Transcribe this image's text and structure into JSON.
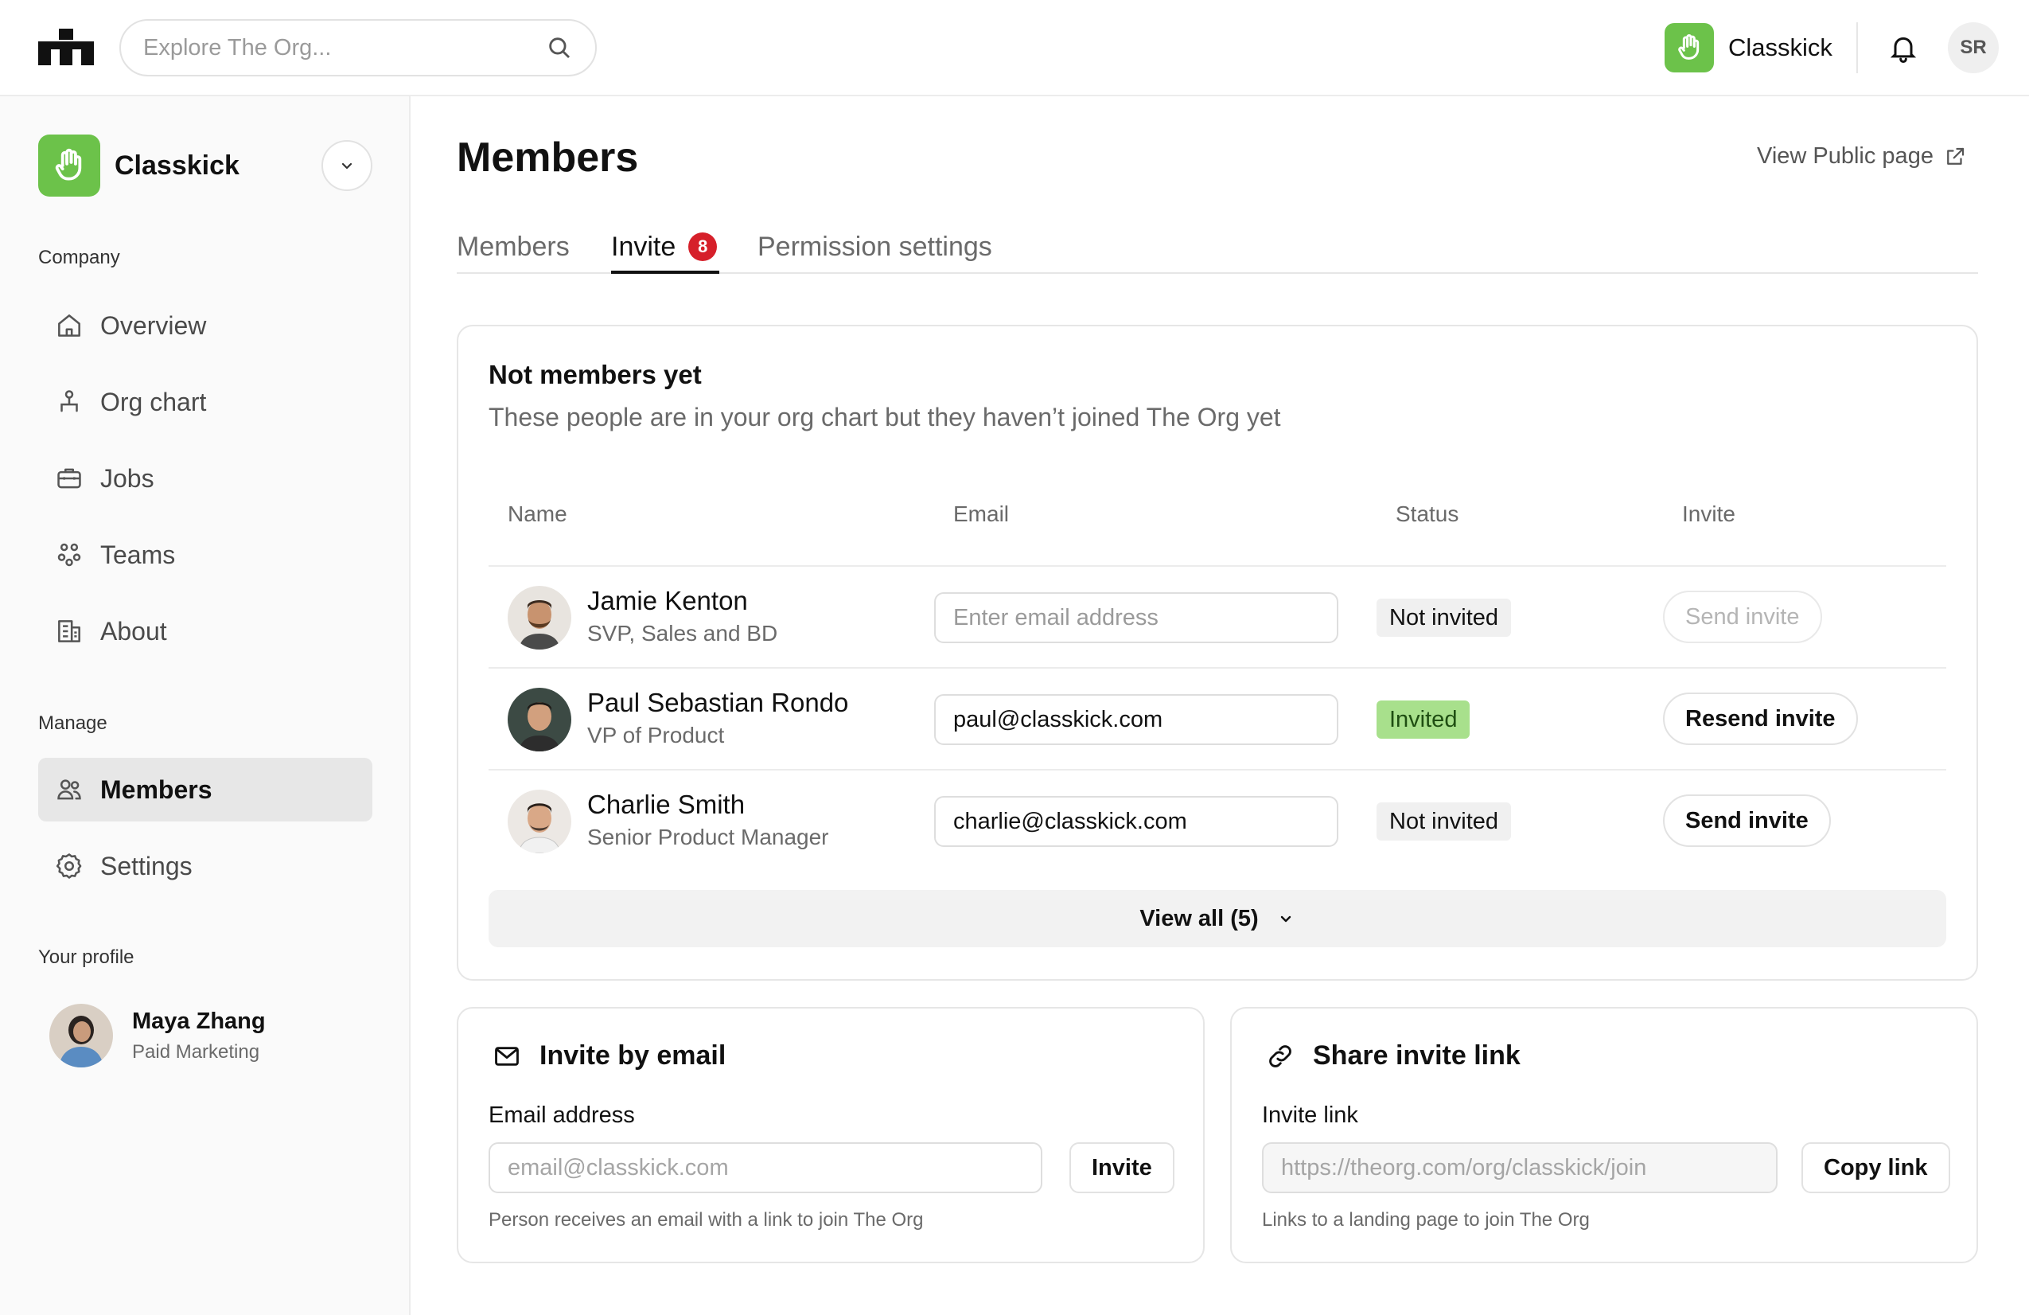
{
  "topbar": {
    "search_placeholder": "Explore The Org...",
    "org_name": "Classkick",
    "user_initials": "SR"
  },
  "sidebar": {
    "org_name": "Classkick",
    "sections": {
      "company": "Company",
      "manage": "Manage",
      "profile": "Your profile"
    },
    "company_items": [
      {
        "label": "Overview",
        "icon": "home-icon"
      },
      {
        "label": "Org chart",
        "icon": "org-chart-icon"
      },
      {
        "label": "Jobs",
        "icon": "briefcase-icon"
      },
      {
        "label": "Teams",
        "icon": "teams-icon"
      },
      {
        "label": "About",
        "icon": "building-icon"
      }
    ],
    "manage_items": [
      {
        "label": "Members",
        "icon": "members-icon",
        "active": true
      },
      {
        "label": "Settings",
        "icon": "gear-icon",
        "active": false
      }
    ],
    "profile": {
      "name": "Maya Zhang",
      "role": "Paid Marketing"
    }
  },
  "main": {
    "title": "Members",
    "view_public": "View Public page",
    "tabs": [
      {
        "label": "Members",
        "active": false
      },
      {
        "label": "Invite",
        "active": true,
        "badge": "8"
      },
      {
        "label": "Permission settings",
        "active": false
      }
    ],
    "not_members": {
      "title": "Not members yet",
      "subtitle": "These people are in your org chart but they haven’t joined The Org yet",
      "columns": [
        "Name",
        "Email",
        "Status",
        "Invite"
      ],
      "rows": [
        {
          "name": "Jamie Kenton",
          "title": "SVP, Sales and BD",
          "email": "",
          "email_placeholder": "Enter email address",
          "status": "Not invited",
          "action": "Send invite",
          "action_enabled": false
        },
        {
          "name": "Paul Sebastian Rondo",
          "title": "VP of Product",
          "email": "paul@classkick.com",
          "email_placeholder": "",
          "status": "Invited",
          "action": "Resend invite",
          "action_enabled": true
        },
        {
          "name": "Charlie Smith",
          "title": "Senior Product Manager",
          "email": "charlie@classkick.com",
          "email_placeholder": "",
          "status": "Not invited",
          "action": "Send invite",
          "action_enabled": true
        }
      ],
      "view_all": "View all (5)"
    },
    "invite_email": {
      "title": "Invite by email",
      "label": "Email address",
      "placeholder": "email@classkick.com",
      "button": "Invite",
      "help": "Person receives an email with a link to join The Org"
    },
    "share_link": {
      "title": "Share invite link",
      "label": "Invite link",
      "link": "https://theorg.com/org/classkick/join",
      "button": "Copy link",
      "help": "Links to a landing page to join The Org"
    }
  },
  "colors": {
    "brand_green": "#6cc24a",
    "badge_red": "#d6202a",
    "invited_green": "#a8e08c"
  }
}
